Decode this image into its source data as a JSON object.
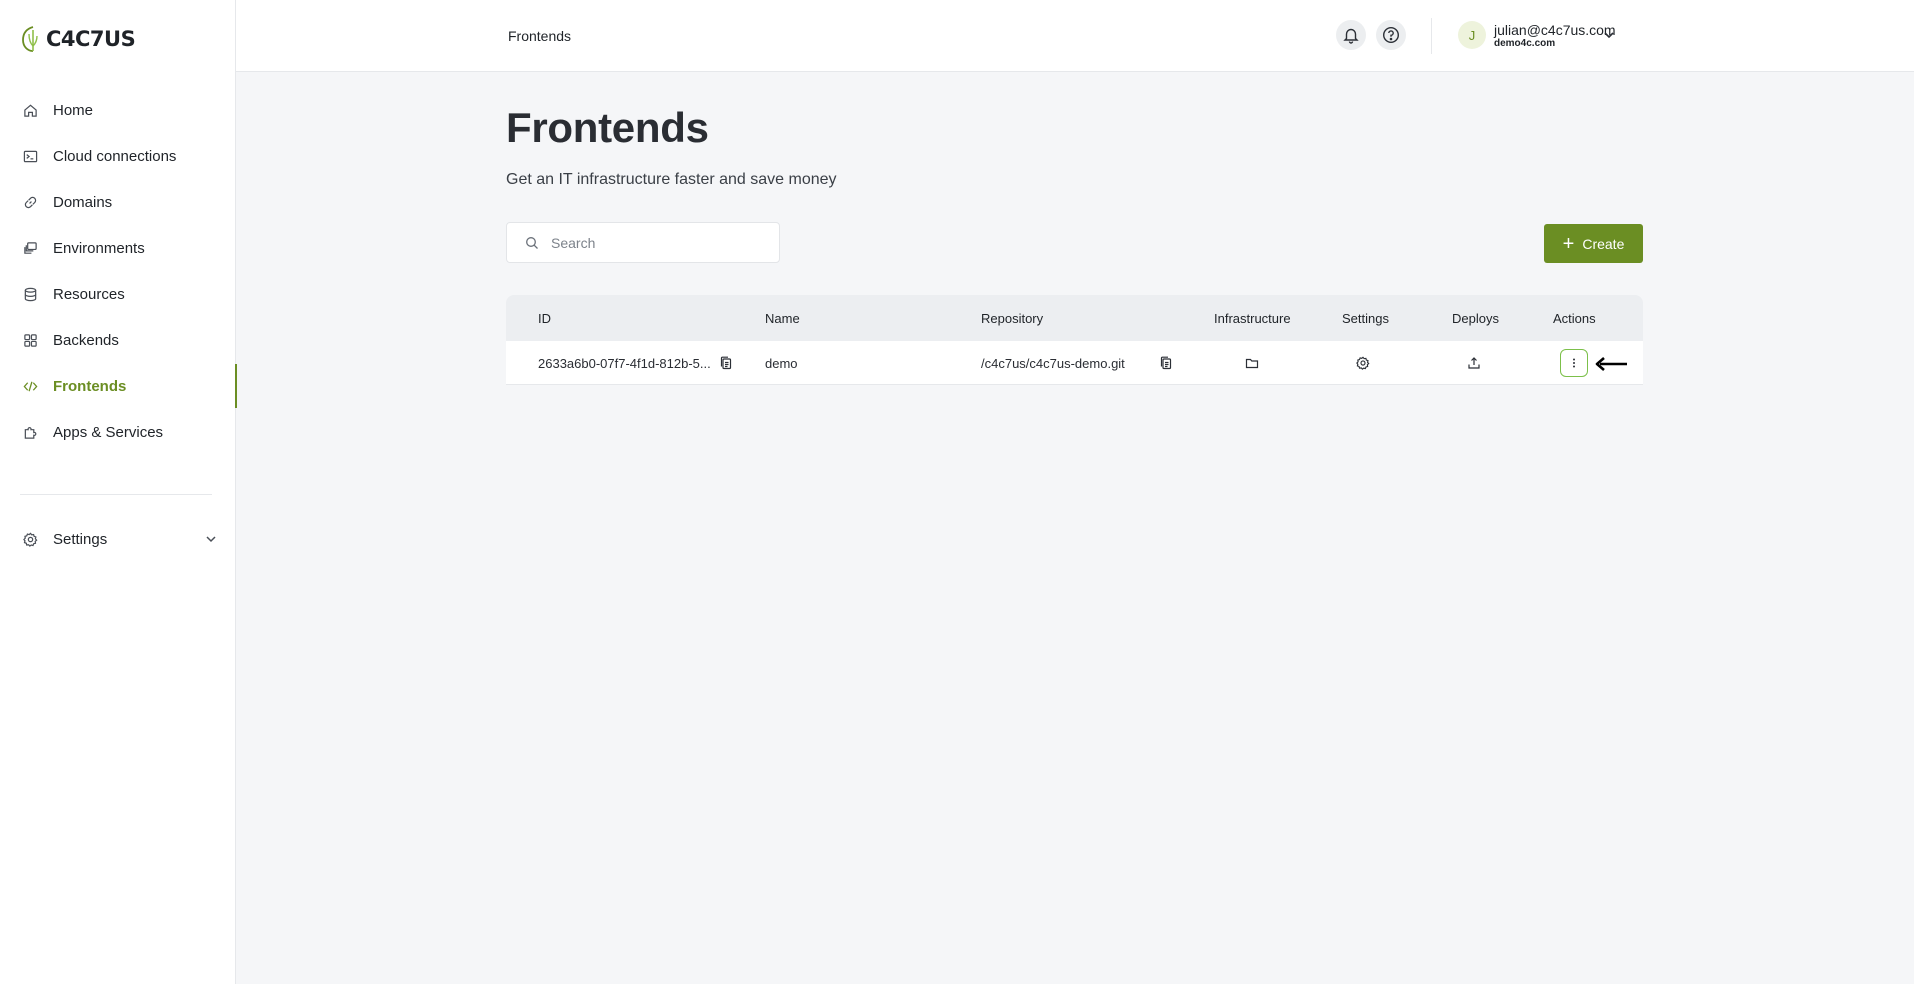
{
  "brand": {
    "name": "C4C7US",
    "accent": "#6b8e23"
  },
  "sidebar": {
    "items": [
      {
        "label": "Home",
        "icon": "home-icon",
        "active": false
      },
      {
        "label": "Cloud connections",
        "icon": "terminal-icon",
        "active": false
      },
      {
        "label": "Domains",
        "icon": "link-icon",
        "active": false
      },
      {
        "label": "Environments",
        "icon": "layers-icon",
        "active": false
      },
      {
        "label": "Resources",
        "icon": "database-icon",
        "active": false
      },
      {
        "label": "Backends",
        "icon": "grid-icon",
        "active": false
      },
      {
        "label": "Frontends",
        "icon": "code-icon",
        "active": true
      },
      {
        "label": "Apps & Services",
        "icon": "puzzle-icon",
        "active": false
      }
    ],
    "settings": {
      "label": "Settings",
      "icon": "gear-icon"
    }
  },
  "topbar": {
    "breadcrumb": "Frontends",
    "user": {
      "initial": "J",
      "email": "julian@c4c7us.com",
      "org": "demo4c.com"
    }
  },
  "page": {
    "title": "Frontends",
    "subtitle": "Get an IT infrastructure faster and save money",
    "search_placeholder": "Search",
    "create_label": "Create"
  },
  "table": {
    "headers": {
      "id": "ID",
      "name": "Name",
      "repository": "Repository",
      "infrastructure": "Infrastructure",
      "settings": "Settings",
      "deploys": "Deploys",
      "actions": "Actions"
    },
    "rows": [
      {
        "id": "2633a6b0-07f7-4f1d-812b-5...",
        "name": "demo",
        "repository": "/c4c7us/c4c7us-demo.git"
      }
    ]
  }
}
